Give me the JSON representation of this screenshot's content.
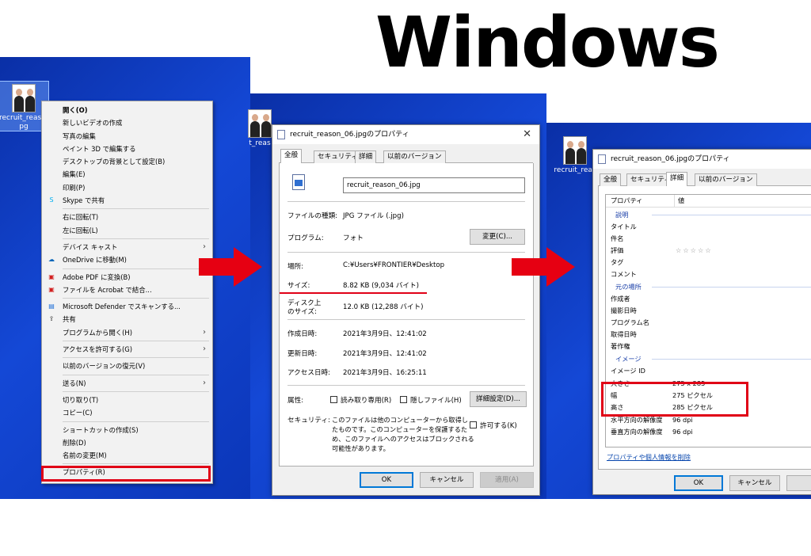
{
  "heading": "Windows",
  "file": {
    "name_label": "recruit_reason_",
    "name_label_2": "pg",
    "short_label_1": "t_reas",
    "short_label_2": "recruit_reas"
  },
  "context_menu": {
    "items": [
      {
        "label": "開く(O)",
        "bold": true
      },
      {
        "label": "新しいビデオの作成"
      },
      {
        "label": "写真の編集"
      },
      {
        "label": "ペイント 3D で編集する"
      },
      {
        "label": "デスクトップの背景として設定(B)"
      },
      {
        "label": "編集(E)"
      },
      {
        "label": "印刷(P)"
      },
      {
        "label": "Skype で共有",
        "icon": "skype-icon"
      },
      {
        "label": "右に回転(T)"
      },
      {
        "label": "左に回転(L)"
      },
      {
        "label": "デバイス キャスト",
        "sub": true
      },
      {
        "label": "OneDrive に移動(M)",
        "icon": "onedrive-icon"
      },
      {
        "label": "Adobe PDF に変換(B)",
        "icon": "pdf-icon"
      },
      {
        "label": "ファイルを Acrobat で結合...",
        "icon": "acrobat-icon"
      },
      {
        "label": "Microsoft Defender でスキャンする...",
        "icon": "defender-icon"
      },
      {
        "label": "共有",
        "icon": "share-icon"
      },
      {
        "label": "プログラムから開く(H)",
        "sub": true
      },
      {
        "label": "アクセスを許可する(G)",
        "sub": true
      },
      {
        "label": "以前のバージョンの復元(V)"
      },
      {
        "label": "送る(N)",
        "sub": true
      },
      {
        "label": "切り取り(T)"
      },
      {
        "label": "コピー(C)"
      },
      {
        "label": "ショートカットの作成(S)"
      },
      {
        "label": "削除(D)"
      },
      {
        "label": "名前の変更(M)"
      },
      {
        "label": "プロパティ(R)"
      }
    ]
  },
  "dialog1": {
    "title": "recruit_reason_06.jpgのプロパティ",
    "tabs": [
      "全般",
      "セキュリティ",
      "詳細",
      "以前のバージョン"
    ],
    "filename": "recruit_reason_06.jpg",
    "type_label": "ファイルの種類:",
    "type_value": "JPG ファイル (.jpg)",
    "program_label": "プログラム:",
    "program_value": "フォト",
    "change_button": "変更(C)...",
    "location_label": "場所:",
    "location_value": "C:¥Users¥FRONTIER¥Desktop",
    "size_label": "サイズ:",
    "size_value": "8.82 KB (9,034 バイト)",
    "disk_label_1": "ディスク上",
    "disk_label_2": "のサイズ:",
    "disk_value": "12.0 KB (12,288 バイト)",
    "created_label": "作成日時:",
    "created_value": "2021年3月9日、12:41:02",
    "modified_label": "更新日時:",
    "modified_value": "2021年3月9日、12:41:02",
    "accessed_label": "アクセス日時:",
    "accessed_value": "2021年3月9日、16:25:11",
    "attr_label": "属性:",
    "readonly_label": "読み取り専用(R)",
    "hidden_label": "隠しファイル(H)",
    "advanced_button": "詳細設定(D)...",
    "security_label": "セキュリティ:",
    "security_text_1": "このファイルは他のコンピューターから取得し",
    "security_text_2": "たものです。このコンピューターを保護するた",
    "security_text_3": "め、このファイルへのアクセスはブロックされる",
    "security_text_4": "可能性があります。",
    "allow_label": "許可する(K)",
    "ok": "OK",
    "cancel": "キャンセル",
    "apply": "適用(A)"
  },
  "dialog2": {
    "title": "recruit_reason_06.jpgのプロパティ",
    "tabs": [
      "全般",
      "セキュリティ",
      "詳細",
      "以前のバージョン"
    ],
    "col_property": "プロパティ",
    "col_value": "値",
    "groups": {
      "description": "説明",
      "origin": "元の場所",
      "image": "イメージ"
    },
    "rows": {
      "title": "タイトル",
      "subject": "件名",
      "rating": "評価",
      "rating_value": "☆☆☆☆☆",
      "tags": "タグ",
      "comments": "コメント",
      "authors": "作成者",
      "date_taken": "撮影日時",
      "program": "プログラム名",
      "acquired": "取得日時",
      "copyright": "著作権",
      "image_id": "イメージ ID",
      "dimensions": "大きさ",
      "dimensions_value": "275 x 285",
      "width": "幅",
      "width_value": "275 ピクセル",
      "height": "高さ",
      "height_value": "285 ピクセル",
      "hres": "水平方向の解像度",
      "hres_value": "96 dpi",
      "vres": "垂直方向の解像度",
      "vres_value": "96 dpi"
    },
    "remove_link": "プロパティや個人情報を削除",
    "ok": "OK",
    "cancel": "キャンセル"
  },
  "colors": {
    "desktop": "#0b36b8",
    "arrow": "#e60012",
    "highlight": "#e00016"
  }
}
